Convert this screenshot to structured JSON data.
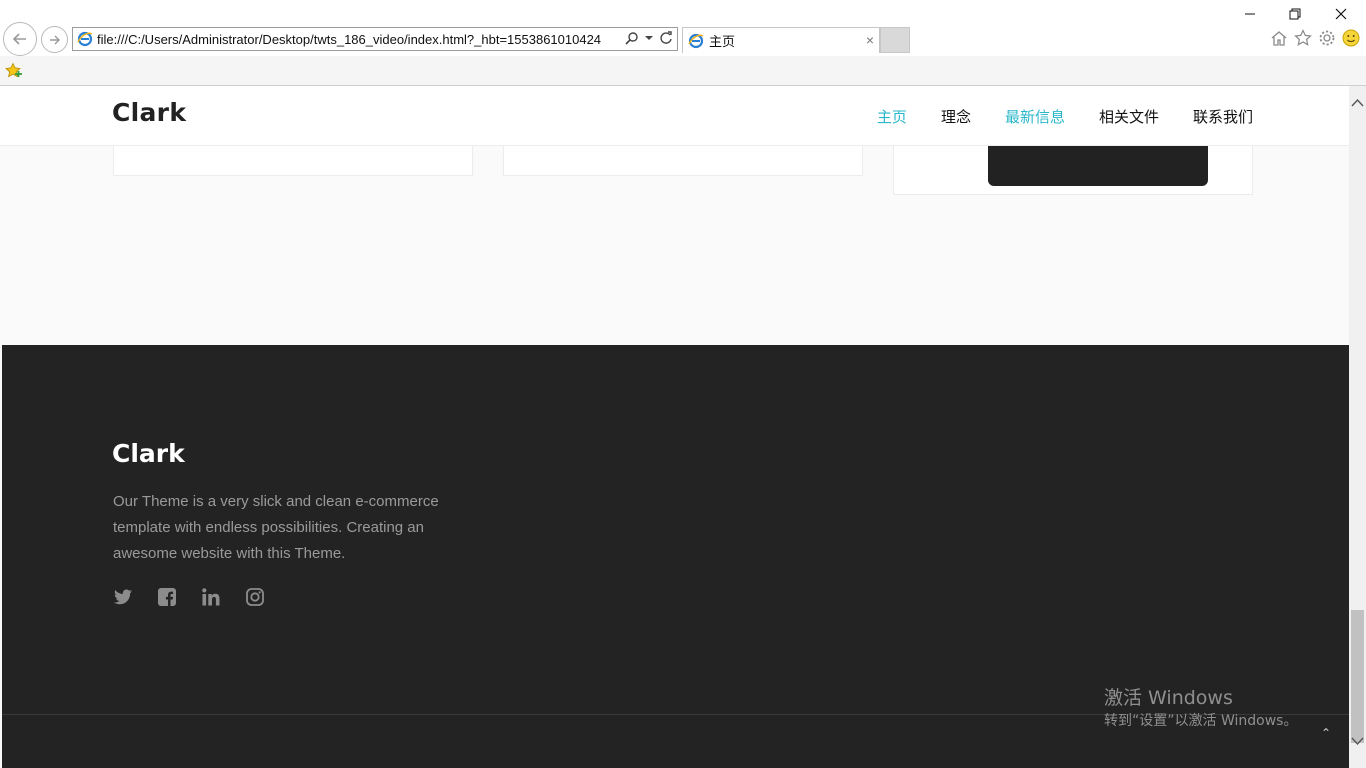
{
  "browser": {
    "url": "file:///C:/Users/Administrator/Desktop/twts_186_video/index.html?_hbt=1553861010424",
    "tab_title": "主页",
    "tab_close": "×"
  },
  "site": {
    "logo": "Clark",
    "nav": [
      {
        "label": "主页",
        "active": true
      },
      {
        "label": "理念",
        "active": false
      },
      {
        "label": "最新信息",
        "active": true
      },
      {
        "label": "相关文件",
        "active": false
      },
      {
        "label": "联系我们",
        "active": false
      }
    ]
  },
  "footer": {
    "logo": "Clark",
    "description": "Our Theme is a very slick and clean e-commerce template with endless possibilities. Creating an awesome website with this Theme.",
    "social": [
      "twitter-icon",
      "facebook-icon",
      "linkedin-icon",
      "instagram-icon"
    ],
    "to_top": "⌃"
  },
  "watermark": {
    "line1": "激活 Windows",
    "line2": "转到“设置”以激活 Windows。"
  },
  "colors": {
    "accent": "#2ab7ca",
    "footer_bg": "#232323",
    "page_bg": "#fafafa"
  }
}
